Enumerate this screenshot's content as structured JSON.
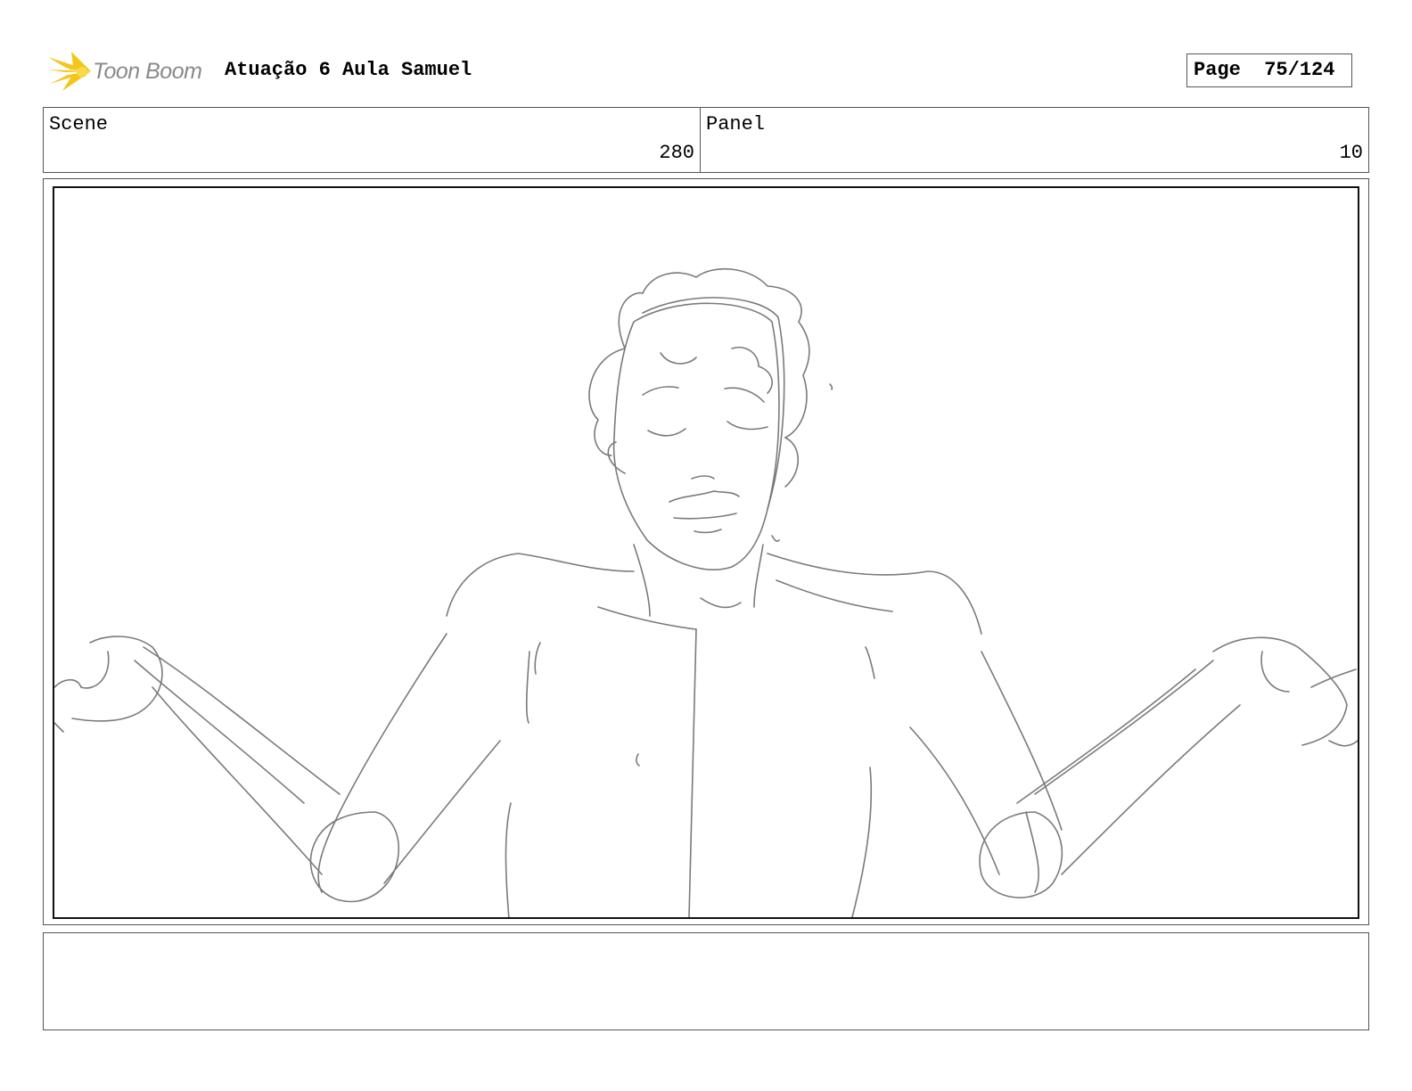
{
  "header": {
    "logo_icon": "starburst-icon",
    "logo_text": "Toon Boom",
    "title": "Atuação 6 Aula Samuel",
    "page_label": "Page",
    "page_number": "75/124"
  },
  "info": {
    "scene_label": "Scene",
    "scene_value": "280",
    "panel_label": "Panel",
    "panel_value": "10"
  },
  "notes": {
    "text": ""
  },
  "colors": {
    "logo_star": "#f5c518",
    "logo_text": "#8a8a8a",
    "sketch_stroke": "#7a7a7a"
  }
}
